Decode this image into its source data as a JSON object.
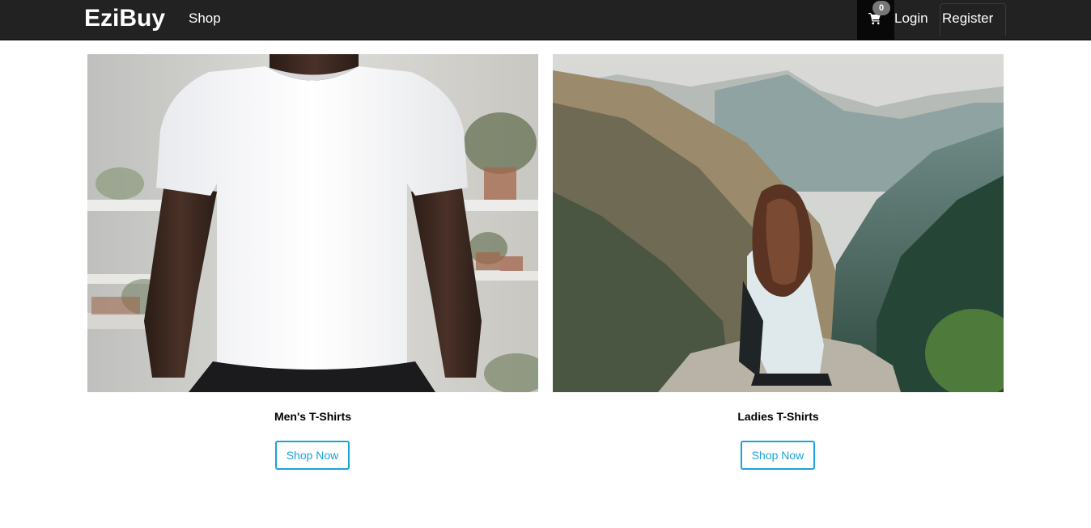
{
  "navbar": {
    "brand": "EziBuy",
    "shop_link": "Shop",
    "cart_count": "0",
    "login_link": "Login",
    "register_link": "Register"
  },
  "categories": [
    {
      "title": "Men's T-Shirts",
      "button_label": "Shop Now"
    },
    {
      "title": "Ladies T-Shirts",
      "button_label": "Shop Now"
    }
  ],
  "colors": {
    "navbar_bg": "#222222",
    "accent": "#1aa3d9",
    "badge_bg": "#777777"
  },
  "icons": {
    "cart": "shopping-cart-icon"
  }
}
